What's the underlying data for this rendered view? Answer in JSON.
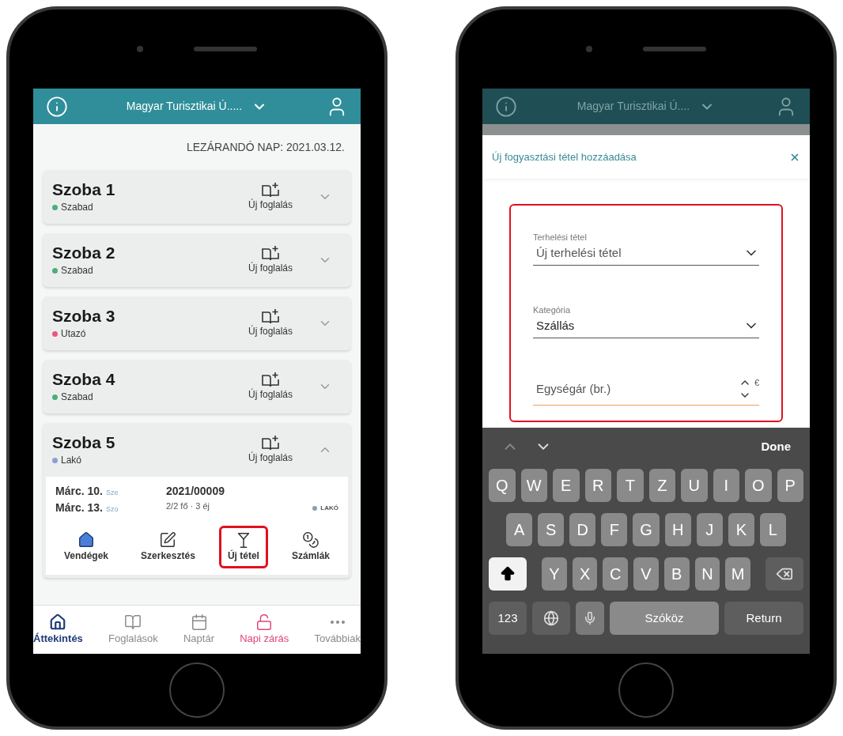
{
  "overview": {
    "header": {
      "title": "Magyar Turisztikai Ú....."
    },
    "closing_date": "LEZÁRANDÓ NAP: 2021.03.12.",
    "rooms": [
      {
        "name": "Szoba 1",
        "status": "Szabad",
        "color": "#4caf7a",
        "action": "Új foglalás",
        "expanded": false
      },
      {
        "name": "Szoba 2",
        "status": "Szabad",
        "color": "#4caf7a",
        "action": "Új foglalás",
        "expanded": false
      },
      {
        "name": "Szoba 3",
        "status": "Utazó",
        "color": "#e8587e",
        "action": "Új foglalás",
        "expanded": false
      },
      {
        "name": "Szoba 4",
        "status": "Szabad",
        "color": "#4caf7a",
        "action": "Új foglalás",
        "expanded": false
      },
      {
        "name": "Szoba 5",
        "status": "Lakó",
        "color": "#8c9fd6",
        "action": "Új foglalás",
        "expanded": true,
        "booking": {
          "arrival": "Márc. 10.",
          "arrival_day": "Sze",
          "departure": "Márc. 13.",
          "departure_day": "Szo",
          "number": "2021/00009",
          "guests": "2/2 fő · 3 éj",
          "status": "LAKÓ",
          "color": "#8aa0b0",
          "actions": [
            {
              "label": "Vendégek",
              "kind": "guests",
              "highlighted": false
            },
            {
              "label": "Szerkesztés",
              "kind": "edit",
              "highlighted": false
            },
            {
              "label": "Új tétel",
              "kind": "item",
              "highlighted": true
            },
            {
              "label": "Számlák",
              "kind": "invoices",
              "highlighted": false
            }
          ]
        }
      }
    ],
    "nav": [
      {
        "label": "Áttekintés",
        "kind": "home",
        "selected": true,
        "color": "#1d3b78"
      },
      {
        "label": "Foglalások",
        "kind": "bookings",
        "selected": false,
        "color": "#8a8a8a"
      },
      {
        "label": "Naptár",
        "kind": "calendar",
        "selected": false,
        "color": "#8a8a8a"
      },
      {
        "label": "Napi zárás",
        "kind": "closing",
        "selected": false,
        "color": "#e0457b"
      },
      {
        "label": "Továbbiak",
        "kind": "more",
        "selected": false,
        "color": "#8a8a8a"
      }
    ]
  },
  "form_screen": {
    "header": {
      "title": "Magyar Turisztikai Ú...."
    },
    "modal": {
      "title": "Új fogyasztási tétel hozzáadása",
      "highlighted": true,
      "fields": [
        {
          "kind": "select",
          "label": "Terhelési tétel",
          "value": "Új terhelési tétel"
        },
        {
          "kind": "select",
          "label": "Kategória",
          "value": "Szállás"
        },
        {
          "kind": "number",
          "placeholder": "Egységár (br.)",
          "unit": "€"
        }
      ]
    },
    "keyboard": {
      "done": "Done",
      "shift_on": true,
      "number_key": "123",
      "space": "Szóköz",
      "return": "Return",
      "rows": [
        [
          "Q",
          "W",
          "E",
          "R",
          "T",
          "Z",
          "U",
          "I",
          "O",
          "P"
        ],
        [
          "A",
          "S",
          "D",
          "F",
          "G",
          "H",
          "J",
          "K",
          "L"
        ],
        [
          "Y",
          "X",
          "C",
          "V",
          "B",
          "N",
          "M"
        ]
      ]
    }
  }
}
